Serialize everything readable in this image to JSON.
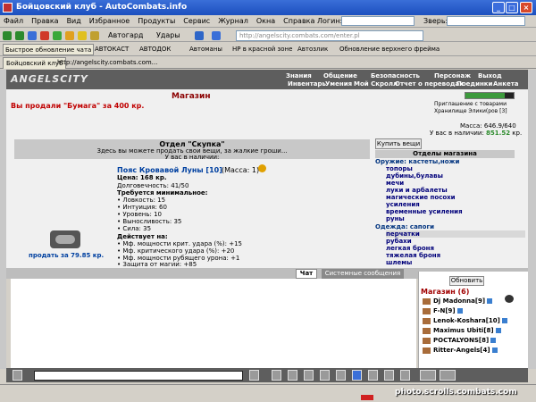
{
  "window": {
    "title": "Бойцовский клуб - AutoCombats.info"
  },
  "menu": [
    "Файл",
    "Правка",
    "Вид",
    "Избранное",
    "Продукты",
    "Сервис",
    "Журнал",
    "Окна",
    "Справка"
  ],
  "menu_fields": {
    "login_label": "Логин:",
    "beast_label": "Зверь:"
  },
  "toolbar": {
    "autoguard": "Автогард",
    "kicks": "Удары",
    "address": "http://angelscity.combats.com/enter.pl"
  },
  "links": [
    "Быстрое обновление чата",
    "АВТОКАСТ",
    "АВТОДОК",
    "Автоманы",
    "HP в красной зоне",
    "Автозлик",
    "Обновление верхнего фрейма"
  ],
  "tabs": {
    "active": "Бойцовский клуб",
    "url": "http://angelscity.combats.com..."
  },
  "game": {
    "logo": "ANGELSCITY",
    "nav_top": [
      "Знания",
      "Общение",
      "Безопасность",
      "Персонаж",
      "Выход"
    ],
    "nav_bottom": [
      "Инвентарь",
      "Умения",
      "Мой Скролл",
      "Отчет о переводах",
      "Поединки",
      "Анкета"
    ]
  },
  "shop": {
    "title": "Магазин",
    "sold_message": "Вы продали \"Бумага\" за 400 кр.",
    "right_links": [
      "Приглашение с товарами",
      "Хранилище Элики(ров [3]"
    ],
    "mass": "Масса: 646.9/640",
    "money_label": "У вас в наличии:",
    "money_value": "851.52",
    "money_unit": "кр.",
    "section_title": "Отдел \"Скупка\"",
    "section_desc": "Здесь вы можете продать свои вещи, за жалкие гроши...",
    "section_have": "У вас в наличии:",
    "item": {
      "name": "Пояс Кровавой Луны [10]",
      "mass": "(Масса: 1)",
      "price": "Цена: 168 кр.",
      "durability": "Долговечность: 41/50",
      "req_title": "Требуется минимальное:",
      "reqs": [
        "• Ловкость: 15",
        "• Интуиция: 60",
        "• Уровень: 10",
        "• Выносливость: 35",
        "• Сила: 35"
      ],
      "acts_title": "Действует на:",
      "acts": [
        "• Мф. мощности крит. удара (%): +15",
        "• Мф. критического удара (%): +20",
        "• Мф. мощности рубящего урона: +1",
        "• Защита от магии: +85"
      ],
      "sell_label": "продать за 79.85 кр."
    },
    "buy_button": "Купить вещи",
    "dept_header": "Отделы магазина",
    "departments": [
      {
        "label": "Оружие: кастеты,ножи",
        "level": 0
      },
      {
        "label": "топоры",
        "level": 1
      },
      {
        "label": "дубины,булавы",
        "level": 1
      },
      {
        "label": "мечи",
        "level": 1
      },
      {
        "label": "луки и арбалеты",
        "level": 1
      },
      {
        "label": "магические посохи",
        "level": 1
      },
      {
        "label": "усиления",
        "level": 1
      },
      {
        "label": "временные усиления",
        "level": 1
      },
      {
        "label": "руны",
        "level": 1
      },
      {
        "label": "Одежда: сапоги",
        "level": 0
      },
      {
        "label": "перчатки",
        "level": 1
      },
      {
        "label": "рубахи",
        "level": 1
      },
      {
        "label": "легкая броня",
        "level": 1
      },
      {
        "label": "тяжелая броня",
        "level": 1
      },
      {
        "label": "шлемы",
        "level": 1
      }
    ]
  },
  "chat": {
    "tab_chat": "Чат",
    "tab_system": "Системные сообщения",
    "refresh": "Обновить",
    "room": "Магазин (6)",
    "users": [
      "Dj Madonna[9]",
      "F-N[9]",
      "Lenok-Koshara[10]",
      "Maximus Ubiti[8]",
      "POCTALYONS[8]",
      "Ritter-Angels[4]"
    ]
  },
  "watermark": "photo.scrolls.combats.com"
}
